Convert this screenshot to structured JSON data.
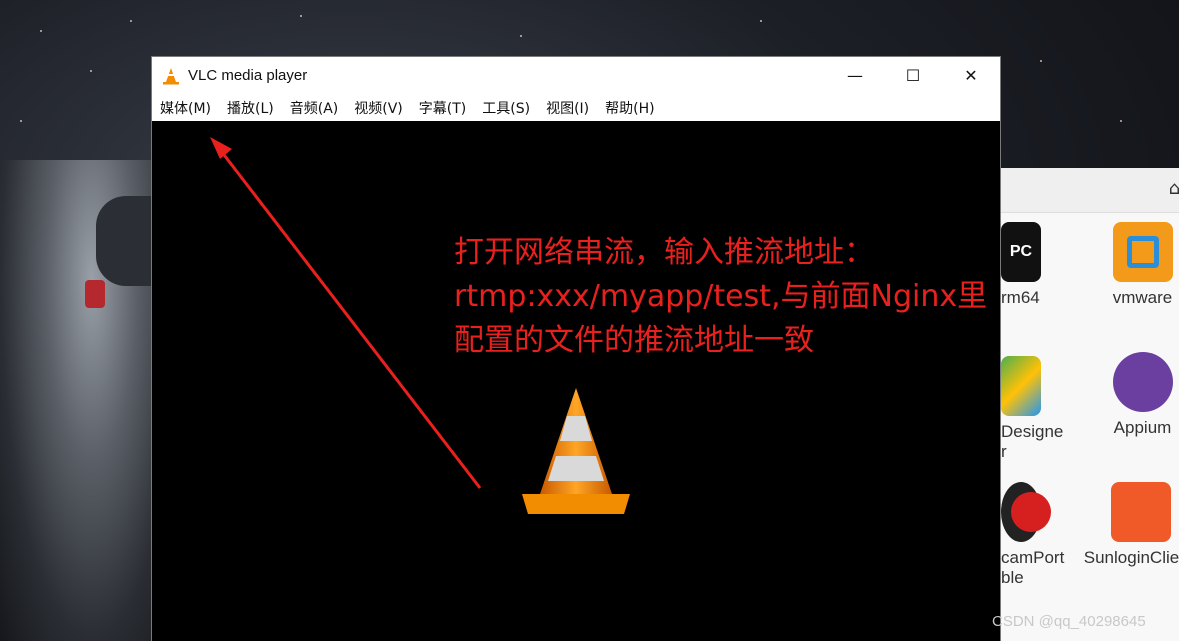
{
  "vlc": {
    "title": "VLC media player",
    "window_buttons": {
      "minimize": "—",
      "maximize": "☐",
      "close": "✕"
    },
    "menu": [
      "媒体(M)",
      "播放(L)",
      "音频(A)",
      "视频(V)",
      "字幕(T)",
      "工具(S)",
      "视图(I)",
      "帮助(H)"
    ],
    "annotation": "打开网络串流，输入推流地址：\nrtmp:xxx/myapp/test,与前面Nginx里\n配置的文件的推流地址一致"
  },
  "explorer": {
    "apps": [
      {
        "label": "rm64"
      },
      {
        "label": "vmware"
      },
      {
        "label": "Designe\nr"
      },
      {
        "label": "Appium"
      },
      {
        "label": "camPort\nble"
      },
      {
        "label": "SunloginClie"
      }
    ]
  },
  "watermark": "CSDN @qq_40298645",
  "colors": {
    "annotation": "#e8201e",
    "vlc_orange": "#f28c00",
    "video_bg": "#000000"
  }
}
